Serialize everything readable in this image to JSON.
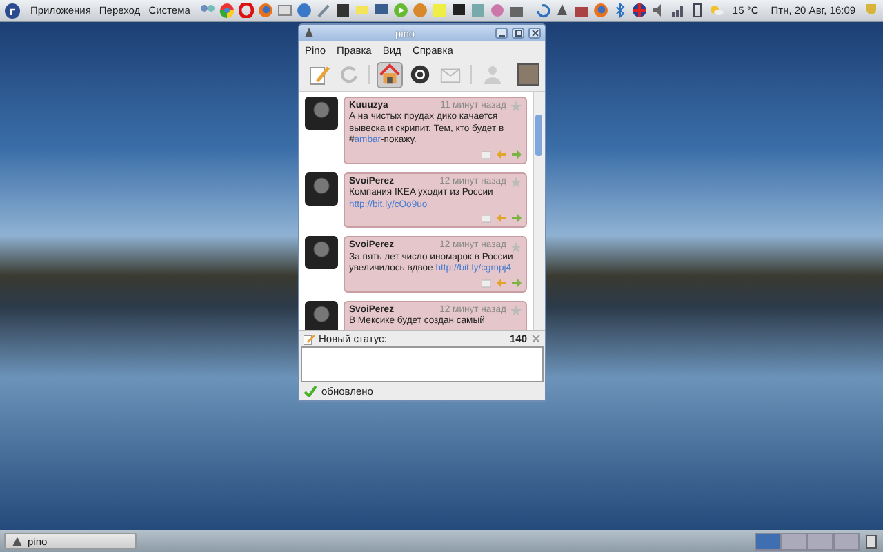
{
  "top_panel": {
    "menus": [
      "Приложения",
      "Переход",
      "Система"
    ],
    "weather": "15 °C",
    "clock": "Птн, 20 Авг, 16:09"
  },
  "window": {
    "title": "pino",
    "menu": [
      "Pino",
      "Правка",
      "Вид",
      "Справка"
    ],
    "views": [
      {
        "kind": "home",
        "selected": true
      },
      {
        "kind": "mentions",
        "selected": false
      },
      {
        "kind": "messages",
        "selected": false
      }
    ],
    "tweets": [
      {
        "user": "Kuuuzya",
        "time": "11 минут назад",
        "parts": [
          {
            "kind": "text",
            "text": "А на чистых прудах дико качается вывеска и скрипит. Тем, кто будет в #"
          },
          {
            "kind": "link",
            "text": "ambar"
          },
          {
            "kind": "text",
            "text": "-покажу."
          }
        ]
      },
      {
        "user": "SvoiPerez",
        "time": "12 минут назад",
        "parts": [
          {
            "kind": "text",
            "text": "Компания IKEA уходит из России "
          },
          {
            "kind": "link",
            "text": "http://bit.ly/cOo9uo"
          }
        ]
      },
      {
        "user": "SvoiPerez",
        "time": "12 минут назад",
        "parts": [
          {
            "kind": "text",
            "text": "За пять лет число иномарок в России увеличилось вдвое "
          },
          {
            "kind": "link",
            "text": "http://bit.ly/cgmpj4"
          }
        ]
      },
      {
        "user": "SvoiPerez",
        "time": "12 минут назад",
        "parts": [
          {
            "kind": "text",
            "text": "В Мексике будет создан самый"
          }
        ]
      }
    ],
    "compose": {
      "label": "Новый статус:",
      "counter": "140"
    },
    "status": "обновлено"
  },
  "taskbar": {
    "items": [
      {
        "label": "pino"
      }
    ]
  }
}
